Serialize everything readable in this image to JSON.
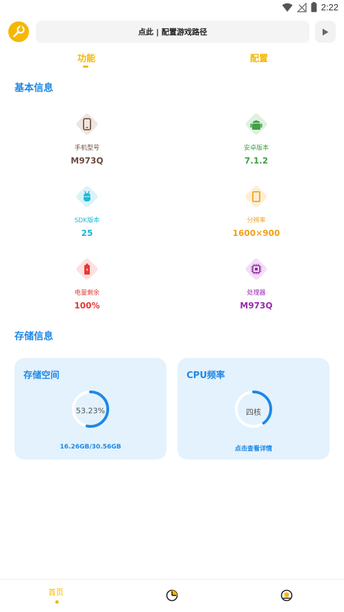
{
  "status_bar": {
    "time": "2:22",
    "icons": [
      "wifi-icon",
      "no-signal-icon",
      "battery-icon"
    ]
  },
  "header": {
    "logo_icon": "wrench-logo-icon",
    "path_label": "点此 | 配置游戏路径",
    "play_icon": "play-icon"
  },
  "tabs": [
    {
      "label": "功能",
      "active": true
    },
    {
      "label": "配置",
      "active": false
    }
  ],
  "basic_info": {
    "title": "基本信息",
    "items": [
      {
        "label": "手机型号",
        "value": "M973Q",
        "icon": "phone-icon",
        "color": "#795548",
        "bg": "#efe5df"
      },
      {
        "label": "安卓版本",
        "value": "7.1.2",
        "icon": "android-icon",
        "color": "#43a047",
        "bg": "#dff1df"
      },
      {
        "label": "SDK版本",
        "value": "25",
        "icon": "sdk-icon",
        "color": "#1eb8d4",
        "bg": "#d9f3f8"
      },
      {
        "label": "分辨率",
        "value": "1600×900",
        "icon": "screen-icon",
        "color": "#f0a21c",
        "bg": "#fdeed3"
      },
      {
        "label": "电量剩余",
        "value": "100%",
        "icon": "battery-level-icon",
        "color": "#e53935",
        "bg": "#fbe1e0"
      },
      {
        "label": "处理器",
        "value": "M973Q",
        "icon": "chip-icon",
        "color": "#9c27b0",
        "bg": "#f1dff4"
      }
    ]
  },
  "storage_info": {
    "title": "存储信息",
    "storage_card": {
      "title": "存储空间",
      "percent_label": "53.23%",
      "percent": 0.5323,
      "footer": "16.26GB/30.56GB"
    },
    "cpu_card": {
      "title": "CPU频率",
      "center_label": "四核",
      "fraction": 0.4,
      "footer": "点击查看详情"
    }
  },
  "colors": {
    "accent": "#f5b800",
    "blue": "#1e88e5",
    "card_bg": "#e3f2fd"
  },
  "bottom_nav": {
    "home_label": "首页",
    "items": [
      "home-tab",
      "chart-tab-icon",
      "profile-tab-icon"
    ]
  }
}
